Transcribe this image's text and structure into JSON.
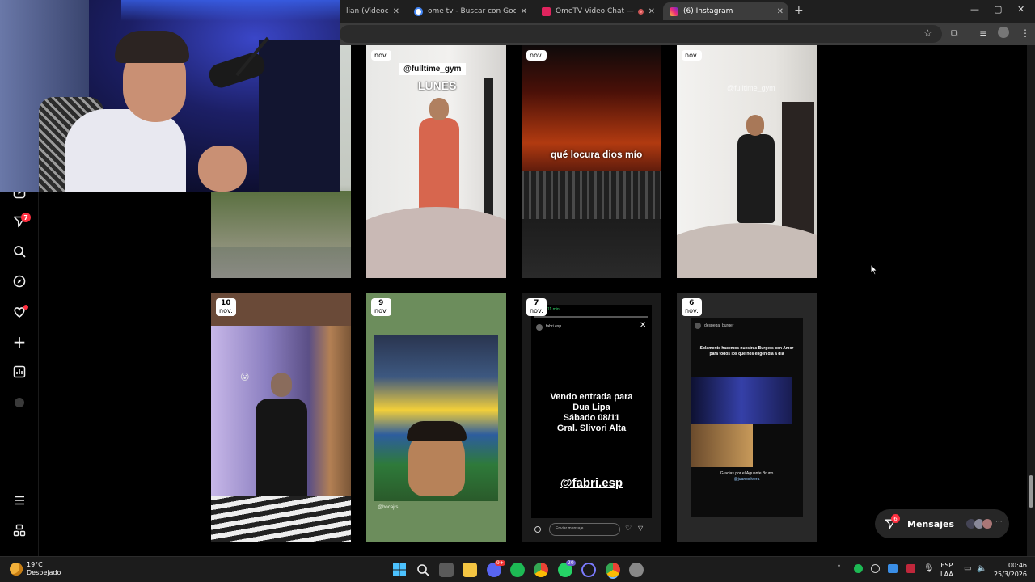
{
  "browser": {
    "tabs": [
      {
        "title": "lian (Videoclip",
        "favicon_color": "#ff0000"
      },
      {
        "title": "ome tv - Buscar con Google",
        "favicon_color": "#ffffff"
      },
      {
        "title": "OmeTV Video Chat — Ome",
        "favicon_color": "#e0245e"
      },
      {
        "title": "(6) Instagram",
        "favicon_color": "#d62976"
      }
    ],
    "new_tab": "+",
    "window_controls": [
      "—",
      "▢",
      "✕"
    ]
  },
  "sidebar": {
    "notifications_badge": "7",
    "items": [
      "reels-icon",
      "messages-icon",
      "search-icon",
      "explore-icon",
      "notifications-icon",
      "create-icon",
      "dashboard-icon",
      "profile-icon",
      "more-icon",
      "meta-icon"
    ]
  },
  "stories": [
    {
      "day": "",
      "month": "nov.",
      "overlay": ""
    },
    {
      "day": "",
      "month": "nov.",
      "overlay": "@fulltime_gym",
      "overlay2": "LUNES"
    },
    {
      "day": "",
      "month": "nov.",
      "overlay": "qué locura dios mío"
    },
    {
      "day": "",
      "month": "nov.",
      "overlay": "@fulltime_gym"
    },
    {
      "day": "10",
      "month": "nov.",
      "overlay": ""
    },
    {
      "day": "9",
      "month": "nov.",
      "overlay": "@bocajrs"
    },
    {
      "day": "7",
      "month": "nov.",
      "header": "fabri.esp",
      "time": "11 min",
      "sale_text": "Vendo entrada para\nDua Lipa\nSábado 08/11\nGral. Slivori Alta",
      "handle": "@fabri.esp",
      "reply_placeholder": "Enviar mensaje..."
    },
    {
      "day": "6",
      "month": "nov.",
      "header": "despega_burger",
      "caption": "Solamente hacemos nuestras Burgers con Amor para todos los que nos eligen día a día",
      "caption2": "Gracias por el Aguante Bruno",
      "handle2": "@juanoslivera"
    }
  ],
  "messages": {
    "label": "Mensajes",
    "badge": "6"
  },
  "taskbar": {
    "temperature": "19°C",
    "weather": "Despejado",
    "lang1": "ESP",
    "lang2": "LAA",
    "time": "00:46",
    "date": "25/3/2026",
    "badges": {
      "discord": "9+",
      "whatsapp": "20"
    }
  }
}
